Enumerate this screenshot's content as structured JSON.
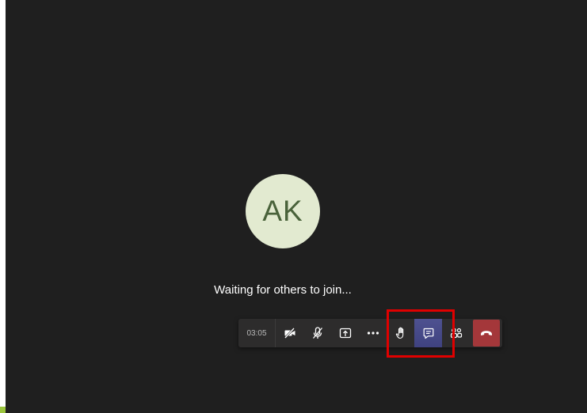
{
  "participant": {
    "initials": "AK",
    "avatar_bg": "#e2ead0",
    "initials_color": "#49623a"
  },
  "status": {
    "waiting_text": "Waiting for others to join..."
  },
  "call_controls": {
    "timer": "03:05",
    "buttons": [
      {
        "name": "camera-toggle",
        "icon": "camera-off-icon"
      },
      {
        "name": "mic-toggle",
        "icon": "mic-off-icon"
      },
      {
        "name": "share-screen",
        "icon": "share-tray-icon"
      },
      {
        "name": "more-actions",
        "icon": "more-dots-icon"
      },
      {
        "name": "raise-hand",
        "icon": "hand-icon"
      },
      {
        "name": "chat",
        "icon": "chat-icon",
        "active": true
      },
      {
        "name": "participants",
        "icon": "people-icon"
      },
      {
        "name": "leave-call",
        "icon": "hang-up-icon"
      }
    ],
    "leave_color": "#a4373a",
    "active_color": "#444791"
  },
  "annotation": {
    "highlight_color": "#e00000"
  }
}
